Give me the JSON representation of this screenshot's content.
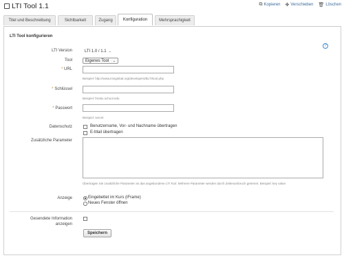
{
  "header": {
    "title": "LTI Tool 1.1",
    "actions": [
      {
        "label": "Kopieren",
        "icon": "copy-icon"
      },
      {
        "label": "Verschieben",
        "icon": "move-icon"
      },
      {
        "label": "Löschen",
        "icon": "trash-icon"
      }
    ]
  },
  "tabs": [
    {
      "label": "Titel und Beschreibung",
      "active": false
    },
    {
      "label": "Sichtbarkeit",
      "active": false
    },
    {
      "label": "Zugang",
      "active": false
    },
    {
      "label": "Konfiguration",
      "active": true
    },
    {
      "label": "Mehrsprachigkeit",
      "active": false
    }
  ],
  "form": {
    "section_title": "LTI Tool konfigurieren",
    "help_icon": "help-icon",
    "lti_version": {
      "label": "LTI Version",
      "value": "LTI 1.0 / 1.1"
    },
    "tool": {
      "label": "Tool",
      "value": "Eigenes Tool"
    },
    "url": {
      "label": "URL",
      "value": "",
      "example": "Beispiel: http://www.imsglobal.org/developers/BLTI/tool.php"
    },
    "key": {
      "label": "Schlüssel",
      "value": "",
      "example": "Beispiel: frentix.school.edu"
    },
    "password": {
      "label": "Passwort",
      "value": "",
      "example": "Beispiel: secret"
    },
    "privacy": {
      "label": "Datenschutz",
      "options": [
        {
          "label": "Benutzername, Vor- und Nachname übertragen",
          "checked": false
        },
        {
          "label": "E-Mail übertragen",
          "checked": false
        }
      ]
    },
    "params": {
      "label": "Zusätzliche Parameter",
      "value": "",
      "hint": "Übertragen Sie zusätzliche Parameter an das angebundene LTI Tool. Mehrere Parameter werden durch Zeilenumbruch getrennt. Beispiel: key value"
    },
    "display": {
      "label": "Anzeige",
      "options": [
        {
          "label": "Eingebettet im Kurs (iFrame)",
          "selected": true
        },
        {
          "label": "Neues Fenster öffnen",
          "selected": false
        }
      ]
    },
    "debug": {
      "label_line1": "Gesendete Information",
      "label_line2": "anzeigen",
      "checked": false
    },
    "save_label": "Speichern"
  }
}
